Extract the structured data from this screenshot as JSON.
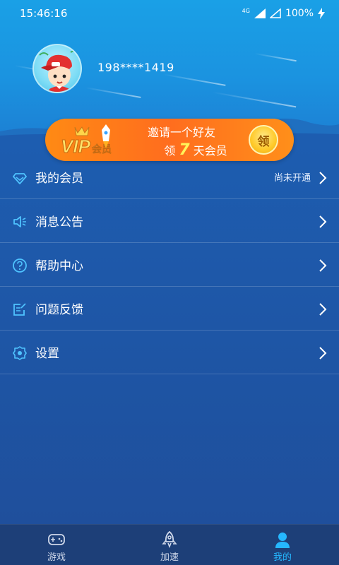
{
  "status_bar": {
    "time": "15:46:16",
    "network": "4G",
    "battery": "100%"
  },
  "profile": {
    "phone": "198****1419"
  },
  "vip_banner": {
    "logo_text": "VIP会员",
    "line1": "邀请一个好友",
    "line2_prefix": "领",
    "days": "7",
    "line2_suffix": "天会员",
    "claim_label": "领"
  },
  "menu": {
    "items": [
      {
        "label": "我的会员",
        "value": "尚未开通",
        "icon": "diamond-icon"
      },
      {
        "label": "消息公告",
        "value": "",
        "icon": "speaker-icon"
      },
      {
        "label": "帮助中心",
        "value": "",
        "icon": "help-icon"
      },
      {
        "label": "问题反馈",
        "value": "",
        "icon": "feedback-icon"
      },
      {
        "label": "设置",
        "value": "",
        "icon": "settings-icon"
      }
    ]
  },
  "bottom_nav": {
    "items": [
      {
        "label": "游戏",
        "icon": "gamepad-icon"
      },
      {
        "label": "加速",
        "icon": "rocket-icon"
      },
      {
        "label": "我的",
        "icon": "user-icon",
        "active": true
      }
    ]
  },
  "colors": {
    "accent": "#25b7ff",
    "banner": "#ff7a1a",
    "background": "#1d5db0"
  }
}
